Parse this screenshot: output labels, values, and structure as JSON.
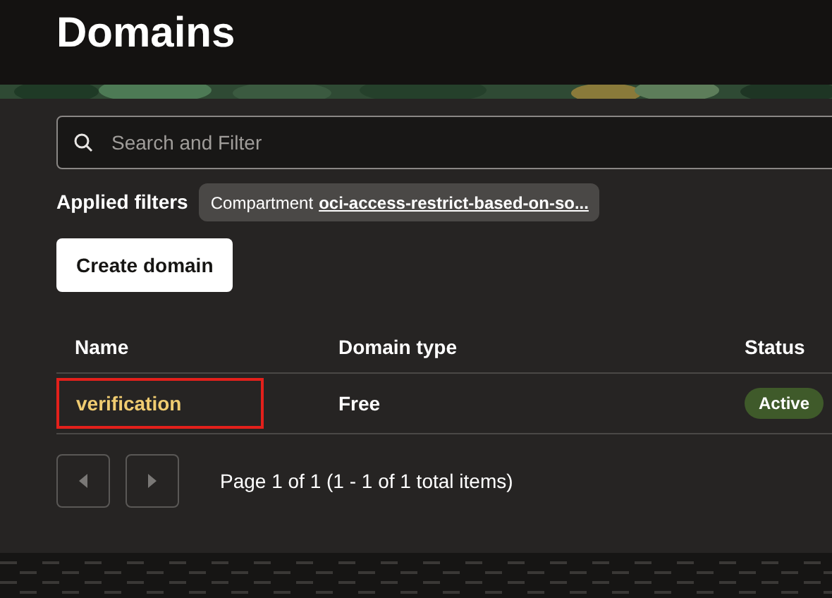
{
  "header": {
    "title": "Domains"
  },
  "search": {
    "placeholder": "Search and Filter"
  },
  "filters": {
    "label": "Applied filters",
    "chips": [
      {
        "name": "Compartment",
        "value": "oci-access-restrict-based-on-so..."
      }
    ]
  },
  "actions": [
    {
      "label": "Create domain"
    }
  ],
  "table": {
    "columns": [
      "Name",
      "Domain type",
      "Status"
    ],
    "rows": [
      {
        "name": "verification",
        "highlighted": true,
        "type": "Free",
        "status": "Active",
        "color": "#3f5a2a"
      }
    ]
  },
  "pagination": {
    "prev_disabled": true,
    "next_disabled": true,
    "summary": "Page 1 of 1 (1 - 1 of 1 total items)"
  }
}
